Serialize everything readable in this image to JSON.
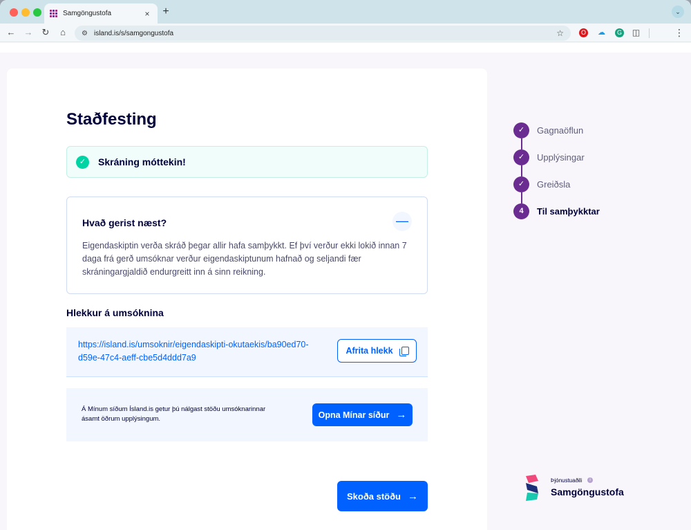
{
  "browser": {
    "tab_title": "Samgöngustofa",
    "tab_close": "×",
    "new_tab": "+",
    "url": "island.is/s/samgongustofa"
  },
  "page": {
    "heading": "Staðfesting",
    "success_message": "Skráning móttekin!",
    "info": {
      "title": "Hvað gerist næst?",
      "body": "Eigendaskiptin verða skráð þegar allir hafa samþykkt. Ef því verður ekki lokið innan 7 daga frá gerð umsóknar verður eigendaskiptunum hafnað og seljandi fær skráningargjaldið endurgreitt inn á sinn reikning."
    },
    "link_section": {
      "heading": "Hlekkur á umsóknina",
      "url": "https://island.is/umsoknir/eigendaskipti-okutaekis/ba90ed70-d59e-47c4-aeff-cbe5d4ddd7a9",
      "copy_label": "Afrita hlekk"
    },
    "my_pages": {
      "text": "Á Mínum síðum Ísland.is getur þú nálgast stöðu umsóknarinnar ásamt öðrum upplýsingum.",
      "button_label": "Opna Mínar síður"
    },
    "status_button_label": "Skoða stöðu"
  },
  "stepper": {
    "steps": [
      {
        "label": "Gagnaöflun",
        "state": "done",
        "marker": "✓"
      },
      {
        "label": "Upplýsingar",
        "state": "done",
        "marker": "✓"
      },
      {
        "label": "Greiðsla",
        "state": "done",
        "marker": "✓"
      },
      {
        "label": "Til samþykktar",
        "state": "active",
        "marker": "4"
      }
    ]
  },
  "org": {
    "role": "Þjónustuaðili",
    "name": "Samgöngustofa"
  },
  "colors": {
    "primary": "#0061ff",
    "stepper": "#6a2c91",
    "success": "#00d4a4",
    "text_dark": "#00003c"
  }
}
